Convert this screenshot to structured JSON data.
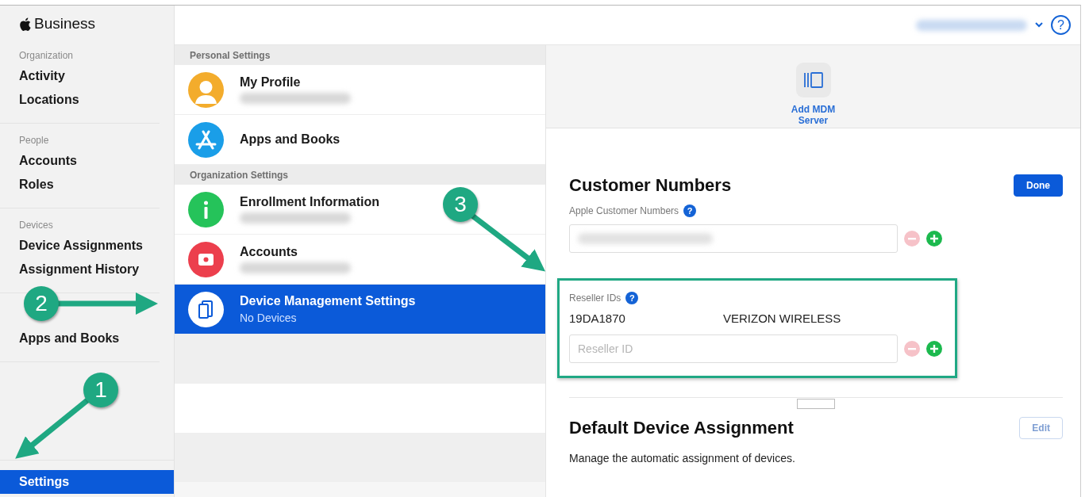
{
  "sidebar": {
    "brand": "Business",
    "sections": [
      {
        "label": "Organization",
        "items": [
          {
            "label": "Activity",
            "selected": false
          },
          {
            "label": "Locations",
            "selected": false
          }
        ]
      },
      {
        "label": "People",
        "items": [
          {
            "label": "Accounts",
            "selected": false
          },
          {
            "label": "Roles",
            "selected": false
          }
        ]
      },
      {
        "label": "Devices",
        "items": [
          {
            "label": "Device Assignments",
            "selected": false
          },
          {
            "label": "Assignment History",
            "selected": false
          }
        ]
      },
      {
        "items": [
          {
            "label": "Apps and Books",
            "selected": false
          }
        ]
      }
    ],
    "footer_items": [
      {
        "label": "Settings",
        "selected": true
      }
    ]
  },
  "settings_list": {
    "sections": [
      {
        "title": "Personal Settings",
        "items": [
          {
            "title": "My Profile",
            "kind": "profile",
            "subtitle_redacted": true,
            "selected": false
          },
          {
            "title": "Apps and Books",
            "kind": "appstore",
            "subtitle_redacted": false,
            "selected": false
          }
        ]
      },
      {
        "title": "Organization Settings",
        "items": [
          {
            "title": "Enrollment Information",
            "kind": "info",
            "subtitle_redacted": true,
            "selected": false
          },
          {
            "title": "Accounts",
            "kind": "card",
            "subtitle_redacted": true,
            "selected": false
          },
          {
            "title": "Device Management Settings",
            "subtitle": "No Devices",
            "kind": "devices",
            "subtitle_redacted": false,
            "selected": true
          }
        ]
      }
    ]
  },
  "header": {
    "account_redacted": true,
    "help": "?"
  },
  "add_server": {
    "label": "Add MDM Server"
  },
  "customer_numbers": {
    "title": "Customer Numbers",
    "button": "Done",
    "apple_numbers": {
      "label": "Apple Customer Numbers",
      "help": "?",
      "value_redacted": true,
      "remove_disabled": true
    },
    "reseller": {
      "label": "Reseller IDs",
      "help": "?",
      "entries": [
        {
          "id": "19DA1870",
          "name": "VERIZON WIRELESS"
        }
      ],
      "placeholder": "Reseller ID",
      "remove_disabled": true
    }
  },
  "default_assignment": {
    "title": "Default Device Assignment",
    "button": "Edit",
    "button_disabled": true,
    "description": "Manage the automatic assignment of devices."
  },
  "callouts": [
    {
      "label": "1"
    },
    {
      "label": "2"
    },
    {
      "label": "3"
    }
  ]
}
